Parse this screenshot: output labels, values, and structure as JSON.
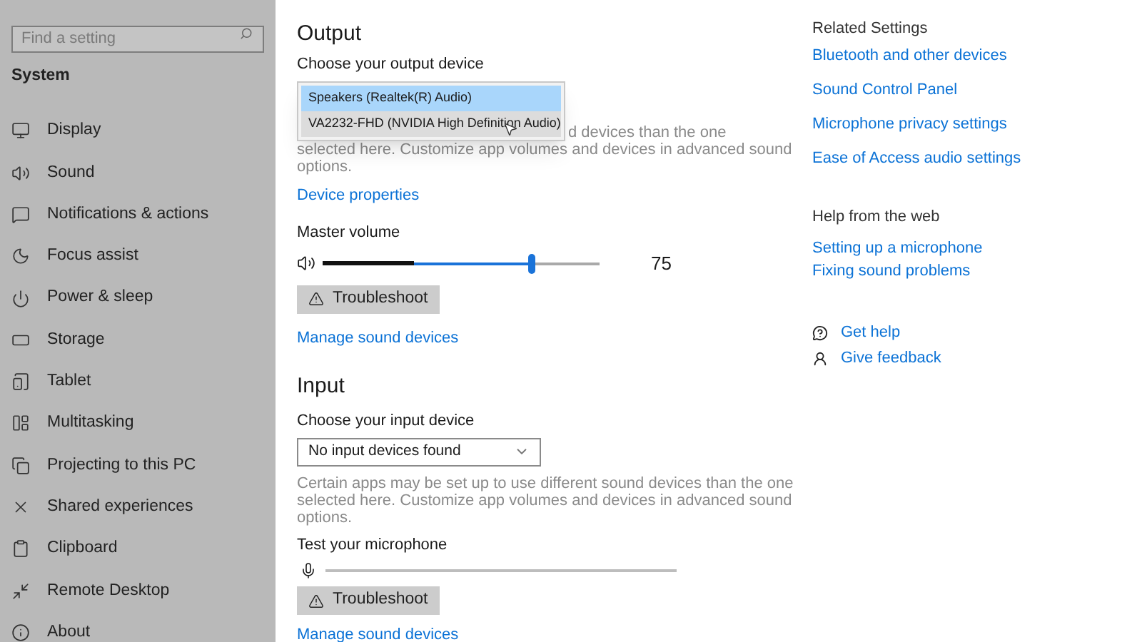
{
  "sidebar": {
    "search": {
      "placeholder": "Find a setting"
    },
    "section": "System",
    "items": [
      {
        "label": "Display",
        "selected": false
      },
      {
        "label": "Sound",
        "selected": false
      },
      {
        "label": "Notifications & actions",
        "selected": false
      },
      {
        "label": "Focus assist",
        "selected": false
      },
      {
        "label": "Power & sleep",
        "selected": false
      },
      {
        "label": "Storage",
        "selected": false
      },
      {
        "label": "Tablet",
        "selected": false
      },
      {
        "label": "Multitasking",
        "selected": false
      },
      {
        "label": "Projecting to this PC",
        "selected": false
      },
      {
        "label": "Shared experiences",
        "selected": false
      },
      {
        "label": "Clipboard",
        "selected": false
      },
      {
        "label": "Remote Desktop",
        "selected": false
      },
      {
        "label": "About",
        "selected": false
      }
    ]
  },
  "output": {
    "heading": "Output",
    "device_label": "Choose your output device",
    "device_options": [
      {
        "label": "Speakers (Realtek(R) Audio)",
        "selected": true,
        "hovered": false
      },
      {
        "label": "VA2232-FHD (NVIDIA High Definition Audio)",
        "selected": false,
        "hovered": true
      }
    ],
    "description_partial_line": "d devices than the one",
    "description_lines": [
      "selected here. Customize app volumes and devices in advanced sound",
      "options."
    ],
    "properties_link": "Device properties",
    "volume_label": "Master volume",
    "volume": {
      "level": 0.75
    },
    "peak": {
      "level": 0.33
    },
    "volume_reading": "75",
    "troubleshoot": "Troubleshoot",
    "manage_link": "Manage sound devices"
  },
  "input": {
    "heading": "Input",
    "device_label": "Choose your input device",
    "device_value": "No input devices found",
    "description_lines": [
      "Certain apps may be set up to use different sound devices than the one",
      "selected here. Customize app volumes and devices in advanced sound",
      "options."
    ],
    "test_label": "Test your microphone",
    "mic_meter": {
      "level": 0
    },
    "troubleshoot": "Troubleshoot",
    "manage_link": "Manage sound devices"
  },
  "related": {
    "heading": "Related Settings",
    "links": [
      "Bluetooth and other devices",
      "Sound Control Panel",
      "Microphone privacy settings",
      "Ease of Access audio settings"
    ]
  },
  "help": {
    "heading": "Help from the web",
    "links": [
      "Setting up a microphone",
      "Fixing sound problems"
    ],
    "actions": [
      {
        "kind": "help",
        "label": "Get help"
      },
      {
        "kind": "feedback",
        "label": "Give feedback"
      }
    ]
  }
}
